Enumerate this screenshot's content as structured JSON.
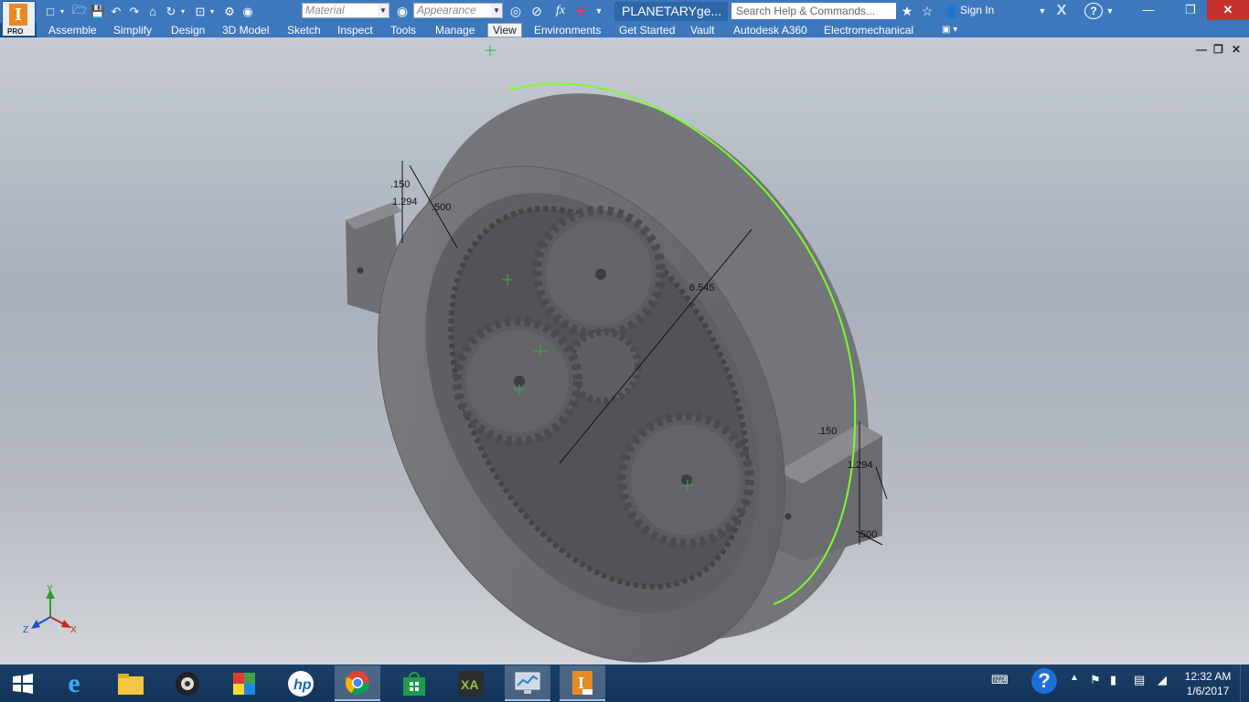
{
  "app": {
    "logo_letter": "I",
    "logo_badge": "PRO",
    "document_title": "PLANETARYge...",
    "search_placeholder": "Search Help & Commands...",
    "sign_in": "Sign In",
    "material_placeholder": "Material",
    "appearance_placeholder": "Appearance",
    "fx_label": "fx"
  },
  "ribbon": {
    "tabs": [
      {
        "label": "Assemble"
      },
      {
        "label": "Simplify"
      },
      {
        "label": "Design"
      },
      {
        "label": "3D Model"
      },
      {
        "label": "Sketch"
      },
      {
        "label": "Inspect"
      },
      {
        "label": "Tools"
      },
      {
        "label": "Manage"
      },
      {
        "label": "View",
        "active": true
      },
      {
        "label": "Environments"
      },
      {
        "label": "Get Started"
      },
      {
        "label": "Vault"
      },
      {
        "label": "Autodesk A360"
      },
      {
        "label": "Electromechanical"
      }
    ]
  },
  "model": {
    "dimensions": {
      "d_left_150": ".150",
      "d_left_1294": "1.294",
      "d_left_500": ".500",
      "d_diameter": "6.545",
      "d_right_150": ".150",
      "d_right_1294": "1.294",
      "d_right_500": ".500"
    },
    "axes": {
      "x": "X",
      "y": "Y",
      "z": "Z"
    },
    "colors": {
      "body": "#6e6f72",
      "body_dark": "#505154",
      "body_light": "#8a8b8e",
      "highlight": "#7cfc2a",
      "background_top": "#c5cad2",
      "background_bottom": "#d3d5d9"
    }
  },
  "taskbar": {
    "clock_time": "12:32 AM",
    "clock_date": "1/6/2017"
  }
}
